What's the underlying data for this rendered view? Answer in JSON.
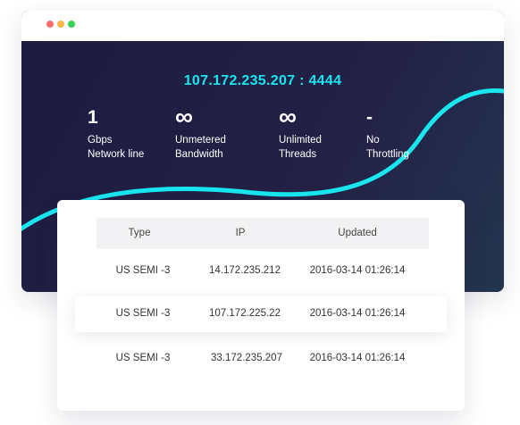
{
  "window": {
    "dot_colors": [
      "#ff6b6b",
      "#ffb74a",
      "#39d353"
    ]
  },
  "hero": {
    "ip_port": "107.172.235.207 : 4444",
    "accent_color": "#19e6ef",
    "stats": [
      {
        "value": "1",
        "line1": "Gbps",
        "line2": "Network line"
      },
      {
        "value": "∞",
        "line1": "Unmetered",
        "line2": "Bandwidth"
      },
      {
        "value": "∞",
        "line1": "Unlimited",
        "line2": "Threads"
      },
      {
        "value": "-",
        "line1": "No",
        "line2": "Throttling"
      }
    ]
  },
  "table": {
    "columns": [
      "Type",
      "IP",
      "Updated"
    ],
    "rows": [
      {
        "type": "US SEMI -3",
        "ip": "14.172.235.212",
        "updated": "2016-03-14 01:26:14"
      },
      {
        "type": "US SEMI -3",
        "ip": "107.172.225.22",
        "updated": "2016-03-14 01:26:14"
      },
      {
        "type": "US SEMI -3",
        "ip": "33.172.235.207",
        "updated": "2016-03-14 01:26:14"
      }
    ]
  }
}
